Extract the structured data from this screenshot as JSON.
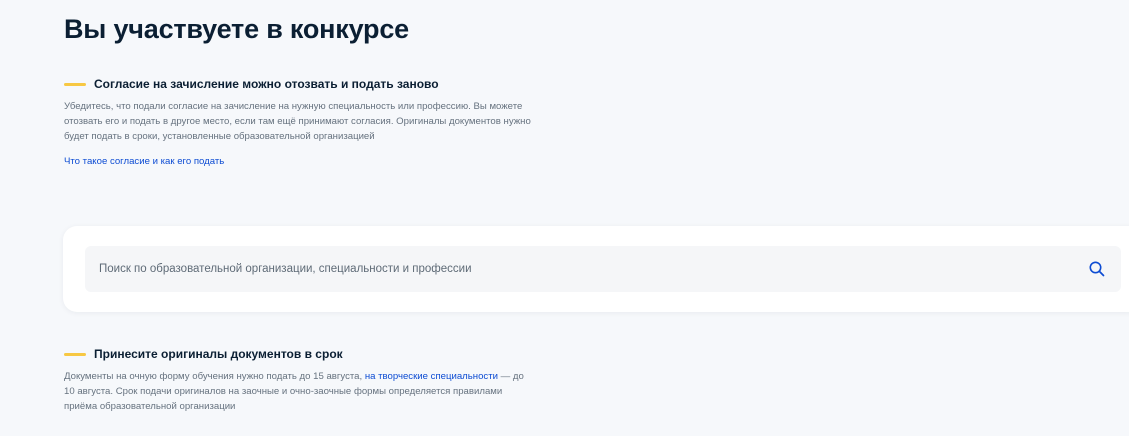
{
  "page": {
    "title": "Вы участвуете в конкурсе"
  },
  "notice_consent": {
    "title": "Согласие на зачисление можно отозвать и подать заново",
    "text": "Убедитесь, что подали согласие на зачисление на нужную специальность или профессию. Вы можете отозвать его и подать в другое место, если там ещё принимают согласия. Оригиналы документов нужно будет подать в сроки, установленные образовательной организацией",
    "link_label": "Что такое согласие и как его подать"
  },
  "search": {
    "placeholder": "Поиск по образовательной организации, специальности и профессии",
    "icon": "search-icon"
  },
  "notice_originals": {
    "title": "Принесите оригиналы документов в срок",
    "text_before_link": "Документы на очную форму обучения нужно подать до 15 августа,",
    "link_label": "на творческие специальности",
    "text_after_link": "— до 10 августа. Срок подачи оригиналов на заочные и очно-заочные формы определяется правилами приёма образовательной организации"
  },
  "colors": {
    "accent_dash": "#f7c843",
    "link": "#0d4cd3",
    "text": "#0b1f33",
    "muted_text": "#66727f",
    "page_background": "#f6f8fb"
  }
}
